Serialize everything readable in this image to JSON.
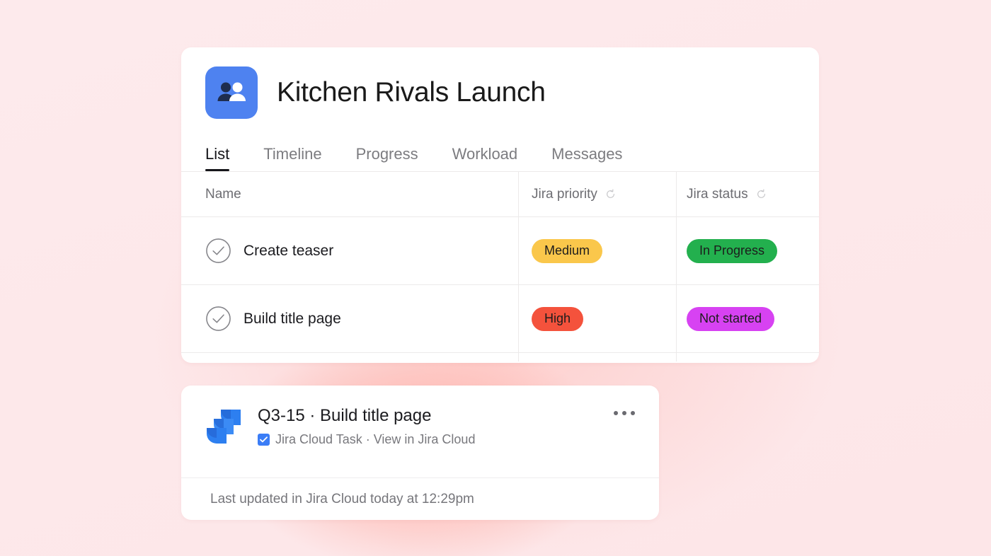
{
  "background": {
    "base_color": "#fde8ea",
    "glow_color": "#ff8e82"
  },
  "project_card": {
    "avatar_icon": "two-people-icon",
    "avatar_bg": "#4e82f0",
    "title": "Kitchen Rivals Launch",
    "tabs": [
      {
        "label": "List",
        "active": true
      },
      {
        "label": "Timeline",
        "active": false
      },
      {
        "label": "Progress",
        "active": false
      },
      {
        "label": "Workload",
        "active": false
      },
      {
        "label": "Messages",
        "active": false
      }
    ],
    "table": {
      "columns": [
        {
          "label": "Name",
          "sync_icon": false
        },
        {
          "label": "Jira priority",
          "sync_icon": true
        },
        {
          "label": "Jira status",
          "sync_icon": true
        }
      ],
      "rows": [
        {
          "check_icon": "circle-check-icon",
          "name": "Create teaser",
          "priority": {
            "label": "Medium",
            "color": "#fac74b"
          },
          "status": {
            "label": "In Progress",
            "color": "#23b04e"
          }
        },
        {
          "check_icon": "circle-check-icon",
          "name": "Build title page",
          "priority": {
            "label": "High",
            "color": "#f4523c"
          },
          "status": {
            "label": "Not started",
            "color": "#d742f2"
          }
        }
      ]
    }
  },
  "jira_card": {
    "logo_icon": "jira-logo-icon",
    "title": "Q3-15 · Build title page",
    "checkbox_checked": true,
    "subtitle": "Jira Cloud Task · View in Jira Cloud",
    "menu_icon": "ellipsis-icon",
    "footer": "Last updated in Jira Cloud today at 12:29pm"
  }
}
